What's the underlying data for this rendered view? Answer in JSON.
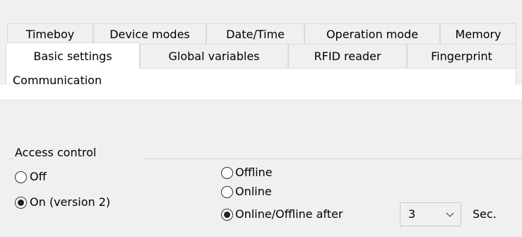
{
  "tabs_row1": [
    "Timeboy",
    "Device modes",
    "Date/Time",
    "Operation mode",
    "Memory"
  ],
  "tabs_row2": [
    "Basic settings",
    "Global variables",
    "RFID reader",
    "Fingerprint"
  ],
  "active_tab": "Basic settings",
  "communication_group": {
    "title": "Communication"
  },
  "access_control": {
    "title": "Access control",
    "mode_options": [
      {
        "label": "Off",
        "checked": false
      },
      {
        "label": "On (version 2)",
        "checked": true
      }
    ],
    "connection_options": [
      {
        "label": "Offline",
        "checked": false
      },
      {
        "label": "Online",
        "checked": false
      },
      {
        "label": "Online/Offline after",
        "checked": true
      }
    ],
    "delay_value": "3",
    "delay_unit": "Sec."
  }
}
